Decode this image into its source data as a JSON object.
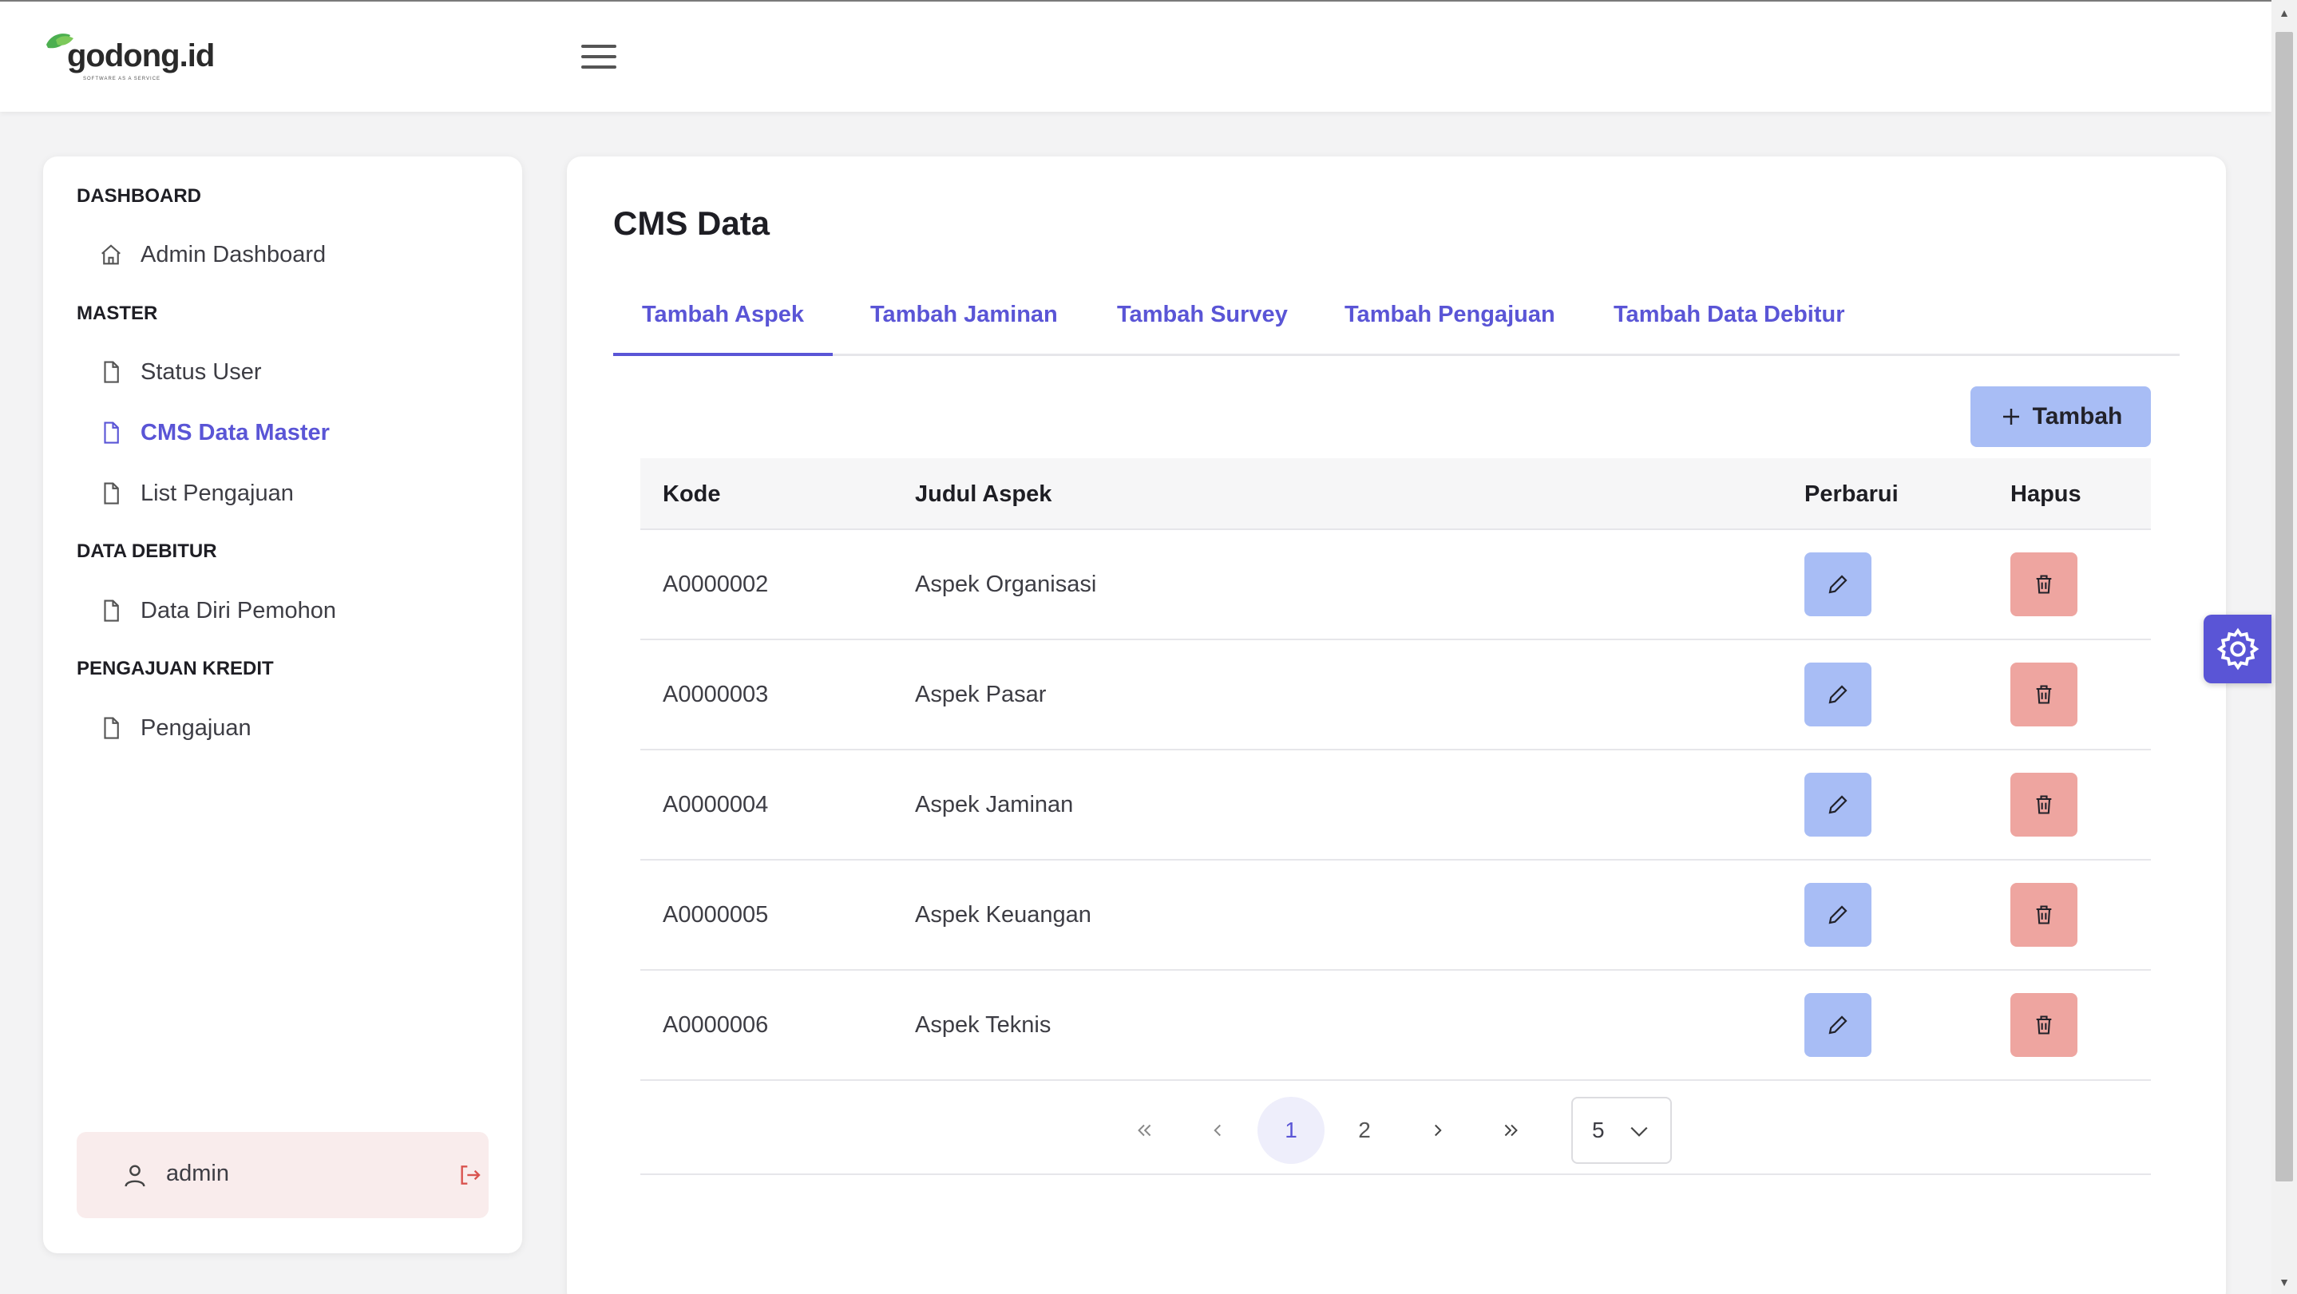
{
  "brand": {
    "name": "godong.id",
    "tagline": "SOFTWARE AS A SERVICE",
    "accent": "#5a55d6"
  },
  "sidebar": {
    "sections": [
      {
        "title": "DASHBOARD",
        "items": [
          {
            "label": "Admin Dashboard",
            "icon": "home-icon"
          }
        ]
      },
      {
        "title": "MASTER",
        "items": [
          {
            "label": "Status User",
            "icon": "file-icon"
          },
          {
            "label": "CMS Data Master",
            "icon": "file-icon",
            "active": true
          },
          {
            "label": "List Pengajuan",
            "icon": "file-icon"
          }
        ]
      },
      {
        "title": "DATA DEBITUR",
        "items": [
          {
            "label": "Data Diri Pemohon",
            "icon": "file-icon"
          }
        ]
      },
      {
        "title": "PENGAJUAN KREDIT",
        "items": [
          {
            "label": "Pengajuan",
            "icon": "file-icon"
          }
        ]
      }
    ],
    "user": {
      "name": "admin"
    }
  },
  "main": {
    "title": "CMS Data",
    "tabs": [
      {
        "label": "Tambah Aspek",
        "active": true
      },
      {
        "label": "Tambah Jaminan"
      },
      {
        "label": "Tambah Survey"
      },
      {
        "label": "Tambah Pengajuan"
      },
      {
        "label": "Tambah Data Debitur"
      }
    ],
    "add_button": "Tambah",
    "table": {
      "columns": [
        "Kode",
        "Judul Aspek",
        "Perbarui",
        "Hapus"
      ],
      "rows": [
        {
          "kode": "A0000002",
          "judul": "Aspek Organisasi"
        },
        {
          "kode": "A0000003",
          "judul": "Aspek Pasar"
        },
        {
          "kode": "A0000004",
          "judul": "Aspek Jaminan"
        },
        {
          "kode": "A0000005",
          "judul": "Aspek Keuangan"
        },
        {
          "kode": "A0000006",
          "judul": "Aspek Teknis"
        }
      ]
    },
    "pagination": {
      "pages": [
        "1",
        "2"
      ],
      "current": "1",
      "page_size": "5"
    }
  }
}
